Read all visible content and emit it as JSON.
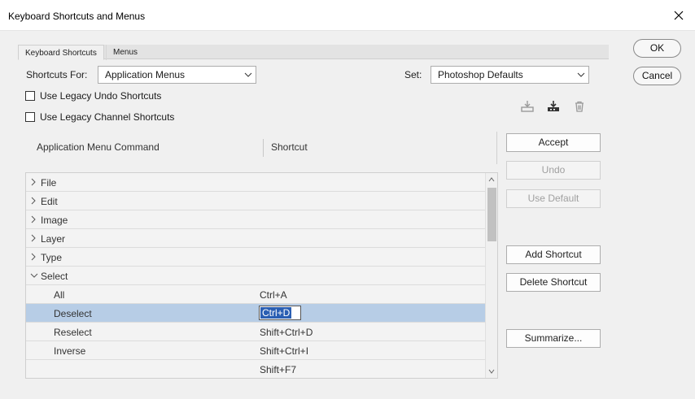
{
  "window": {
    "title": "Keyboard Shortcuts and Menus"
  },
  "tabs": [
    {
      "label": "Keyboard Shortcuts"
    },
    {
      "label": "Menus"
    }
  ],
  "shortcuts_for": {
    "label": "Shortcuts For:",
    "value": "Application Menus"
  },
  "set": {
    "label": "Set:",
    "value": "Photoshop Defaults"
  },
  "checkboxes": [
    {
      "label": "Use Legacy Undo Shortcuts",
      "checked": false
    },
    {
      "label": "Use Legacy Channel Shortcuts",
      "checked": false
    }
  ],
  "columns": {
    "command": "Application Menu Command",
    "shortcut": "Shortcut"
  },
  "rows": [
    {
      "name": "File",
      "expand": "collapsed",
      "shortcut": ""
    },
    {
      "name": "Edit",
      "expand": "collapsed",
      "shortcut": ""
    },
    {
      "name": "Image",
      "expand": "collapsed",
      "shortcut": ""
    },
    {
      "name": "Layer",
      "expand": "collapsed",
      "shortcut": ""
    },
    {
      "name": "Type",
      "expand": "collapsed",
      "shortcut": ""
    },
    {
      "name": "Select",
      "expand": "expanded",
      "shortcut": ""
    },
    {
      "name": "All",
      "expand": "none",
      "shortcut": "Ctrl+A"
    },
    {
      "name": "Deselect",
      "expand": "none",
      "shortcut": "Ctrl+D",
      "selected": true
    },
    {
      "name": "Reselect",
      "expand": "none",
      "shortcut": "Shift+Ctrl+D"
    },
    {
      "name": "Inverse",
      "expand": "none",
      "shortcut": "Shift+Ctrl+I"
    },
    {
      "name": "",
      "expand": "none",
      "shortcut": "Shift+F7"
    }
  ],
  "side_buttons": {
    "accept": "Accept",
    "undo": "Undo",
    "use_default": "Use Default",
    "add_shortcut": "Add Shortcut",
    "delete_shortcut": "Delete Shortcut",
    "summarize": "Summarize..."
  },
  "dialog_buttons": {
    "ok": "OK",
    "cancel": "Cancel"
  },
  "icons": [
    "save-set-icon",
    "save-set-as-icon",
    "delete-set-icon"
  ],
  "colors": {
    "selection": "#b7cde6",
    "edit_highlight": "#2b5fb3"
  }
}
